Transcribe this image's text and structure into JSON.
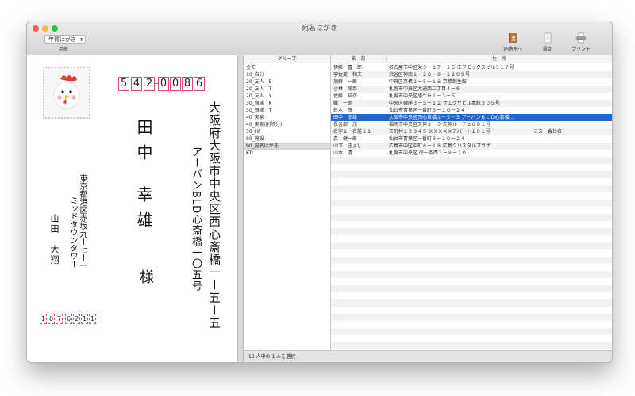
{
  "window": {
    "title": "宛名はがき"
  },
  "toolbar": {
    "paper_select": "年賀はがき",
    "paper_caption": "用紙",
    "buttons": [
      {
        "label": "連絡先へ",
        "icon": "address-book-icon"
      },
      {
        "label": "設定",
        "icon": "settings-icon"
      },
      {
        "label": "プリント",
        "icon": "printer-icon"
      }
    ]
  },
  "postcard": {
    "recipient_zip": [
      "5",
      "4",
      "2",
      "0",
      "0",
      "8",
      "6"
    ],
    "recipient_address_line1": "大阪府大阪市中央区西心斎橋一ー五ー五",
    "recipient_address_line2": "アーバンBLD心斎橋一〇五号",
    "recipient_surname": "田中",
    "recipient_given": "幸雄",
    "honorific": "様",
    "sender_address_line1": "東京都港区赤坂九ー七ー一",
    "sender_address_line2": "ミッドタウンタワー",
    "sender_name": "山田　大翔",
    "sender_zip": [
      "1",
      "0",
      "7",
      "6",
      "2",
      "1",
      "1"
    ]
  },
  "groups": {
    "header": "グループ",
    "items": [
      "全て",
      "10_自分",
      "20_友人　E",
      "20_友人　T",
      "20_友人　Y",
      "30_親戚　K",
      "30_親戚　T",
      "40_実家",
      "40_実家(削除分)",
      "50_HF",
      "80_施設",
      "90_宛名はがき",
      "KTI"
    ],
    "selected_index": 11
  },
  "contacts": {
    "headers": {
      "name": "名　前",
      "address": "住　所"
    },
    "rows": [
      {
        "name": "伊藤　喜一郎",
        "address": "名古屋市中区栄３ー１７ー１５ エフエックスビル３１７号",
        "company": ""
      },
      {
        "name": "宇佐美　和夫",
        "address": "渋谷区神南１ー２０ー９ー１２０９号",
        "company": ""
      },
      {
        "name": "加藤　一郎",
        "address": "中央区京橋２ー５ー１８ 京橋創生館",
        "company": ""
      },
      {
        "name": "小林　陽菜",
        "address": "札幌市中央区大通西二丁目４ー６",
        "company": ""
      },
      {
        "name": "佐藤　結衣",
        "address": "札幌市中央区旭ケ丘１ー３ー５",
        "company": ""
      },
      {
        "name": "織　一郎",
        "address": "中央区銀座３ー５ー１２ サエグサビル本館３０５号",
        "company": ""
      },
      {
        "name": "鈴木　茂",
        "address": "仙台市青葉区一番町３ー１０ー２４",
        "company": ""
      },
      {
        "name": "田中　幸雄",
        "address": "大阪市中央区西心斎橋１ー５ー５ アーバンＢＬＤ心斎橋...",
        "company": ""
      },
      {
        "name": "長谷部　茂",
        "address": "福岡市中央区天神２ー３ 天神ルーチェ８０１号",
        "company": ""
      },
      {
        "name": "名字１　名前１１",
        "address": "市町村１２３４５ ＸＸＸＸＸアパート１０１号",
        "company": "テスト会社名"
      },
      {
        "name": "森　健一郎",
        "address": "仙台市青葉区一番町３ー１０ー２４",
        "company": ""
      },
      {
        "name": "山下　きよし",
        "address": "広島市中区中町８ー１８ 広島クリスタルプラザ",
        "company": ""
      },
      {
        "name": "山本　清",
        "address": "札幌市中央区 南一条西３ー８ー２０",
        "company": ""
      }
    ],
    "selected_index": 7
  },
  "status": {
    "text": "13 人中の 1 人を選択"
  },
  "colors": {
    "accent": "#1e66d0",
    "zip_border": "#e0487a"
  }
}
